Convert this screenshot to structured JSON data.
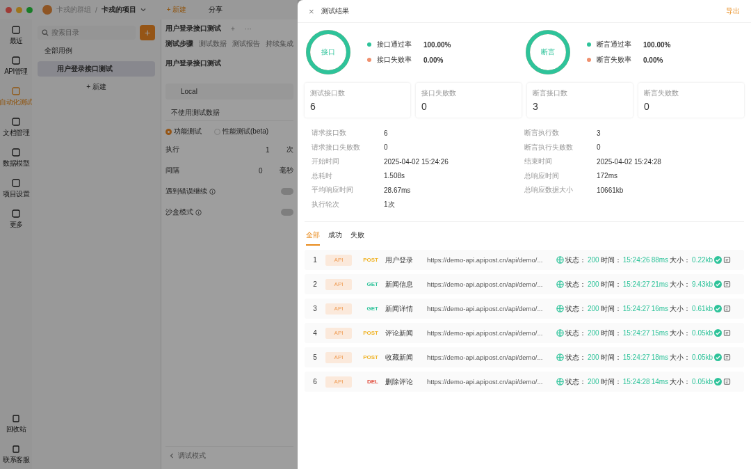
{
  "app": {
    "team": "卡戎的群组",
    "project": "卡戎的项目",
    "new_button": "+ 新建",
    "share_button": "分享",
    "separator": "/",
    "rail": [
      {
        "label": "最近",
        "selected": false
      },
      {
        "label": "API管理",
        "selected": false
      },
      {
        "label": "自动化测试",
        "selected": true
      },
      {
        "label": "文档管理",
        "selected": false
      },
      {
        "label": "数据模型",
        "selected": false
      },
      {
        "label": "项目设置",
        "selected": false
      },
      {
        "label": "更多",
        "selected": false
      }
    ],
    "rail_bottom": [
      {
        "label": "回收站"
      },
      {
        "label": "联系客服"
      }
    ],
    "tree": {
      "search": {
        "placeholder": "搜索目录"
      },
      "add": "+",
      "root": "全部用例",
      "items": [
        {
          "label": "用户登录接口测试",
          "selected": true
        }
      ],
      "new_item": "+ 新建"
    },
    "editor": {
      "tab_title": "用户登录接口测试",
      "tab_add": "+",
      "tab_more": "···",
      "tabs": [
        {
          "label": "测试步骤",
          "selected": true
        },
        {
          "label": "测试数据",
          "selected": false
        },
        {
          "label": "测试报告",
          "selected": false
        },
        {
          "label": "持续集成",
          "selected": false
        }
      ],
      "heading": "用户登录接口测试",
      "env": "Local",
      "data_select": "不使用测试数据",
      "modes": [
        {
          "label": "功能测试",
          "selected": true
        },
        {
          "label": "性能测试(beta)",
          "selected": false
        }
      ],
      "fields": [
        {
          "label": "执行",
          "value": "1",
          "unit": "次"
        },
        {
          "label": "间隔",
          "value": "0",
          "unit": "毫秒"
        }
      ],
      "toggles": [
        {
          "label": "遇到错误继续",
          "on": false
        },
        {
          "label": "沙盒模式",
          "on": false
        }
      ],
      "footer": "调试模式"
    }
  },
  "drawer": {
    "close": "×",
    "title": "测试结果",
    "export": "导出",
    "rings": [
      {
        "label": "接口",
        "level": 1,
        "legend": [
          {
            "label": "接口通过率",
            "value": "100.00%",
            "color": "#2ec39a"
          },
          {
            "label": "接口失败率",
            "value": "0.00%",
            "color": "#f0906e"
          }
        ]
      },
      {
        "label": "断言",
        "level": 1,
        "legend": [
          {
            "label": "断言通过率",
            "value": "100.00%",
            "color": "#2ec39a"
          },
          {
            "label": "断言失败率",
            "value": "0.00%",
            "color": "#f0906e"
          }
        ]
      }
    ],
    "cards": [
      {
        "label": "测试接口数",
        "value": "6"
      },
      {
        "label": "接口失败数",
        "value": "0"
      },
      {
        "label": "断言接口数",
        "value": "3"
      },
      {
        "label": "断言失败数",
        "value": "0"
      }
    ],
    "details_left": [
      {
        "label": "请求接口数",
        "value": "6"
      },
      {
        "label": "请求接口失败数",
        "value": "0"
      },
      {
        "label": "开始时间",
        "value": "2025-04-02 15:24:26"
      },
      {
        "label": "总耗时",
        "value": "1.508s"
      },
      {
        "label": "平均响应时间",
        "value": "28.67ms"
      },
      {
        "label": "执行轮次",
        "value": "1次"
      }
    ],
    "details_right": [
      {
        "label": "断言执行数",
        "value": "3"
      },
      {
        "label": "断言执行失败数",
        "value": "0"
      },
      {
        "label": "结束时间",
        "value": "2025-04-02 15:24:28"
      },
      {
        "label": "总响应时间",
        "value": "172ms"
      },
      {
        "label": "总响应数据大小",
        "value": "10661kb"
      }
    ],
    "filter_tabs": [
      {
        "label": "全部",
        "selected": true
      },
      {
        "label": "成功",
        "selected": false
      },
      {
        "label": "失败",
        "selected": false
      }
    ],
    "rows": [
      {
        "index": "1",
        "badge": "API",
        "method": "POST",
        "color": "#f0b429",
        "name": "用户登录",
        "url": "https://demo-api.apipost.cn/api/demo/...",
        "status_label": "状态：",
        "status": "200",
        "time_label": "时间：",
        "time": "15:24:26",
        "duration": "88ms",
        "size_label": "大小：",
        "size": "0.22kb"
      },
      {
        "index": "2",
        "badge": "API",
        "method": "GET",
        "color": "#2ec39a",
        "name": "新闻信息",
        "url": "https://demo-api.apipost.cn/api/demo/...",
        "status_label": "状态：",
        "status": "200",
        "time_label": "时间：",
        "time": "15:24:27",
        "duration": "21ms",
        "size_label": "大小：",
        "size": "9.43kb"
      },
      {
        "index": "3",
        "badge": "API",
        "method": "GET",
        "color": "#2ec39a",
        "name": "新闻详情",
        "url": "https://demo-api.apipost.cn/api/demo/...",
        "status_label": "状态：",
        "status": "200",
        "time_label": "时间：",
        "time": "15:24:27",
        "duration": "16ms",
        "size_label": "大小：",
        "size": "0.61kb"
      },
      {
        "index": "4",
        "badge": "API",
        "method": "POST",
        "color": "#f0b429",
        "name": "评论新闻",
        "url": "https://demo-api.apipost.cn/api/demo/...",
        "status_label": "状态：",
        "status": "200",
        "time_label": "时间：",
        "time": "15:24:27",
        "duration": "15ms",
        "size_label": "大小：",
        "size": "0.05kb"
      },
      {
        "index": "5",
        "badge": "API",
        "method": "POST",
        "color": "#f0b429",
        "name": "收藏新闻",
        "url": "https://demo-api.apipost.cn/api/demo/...",
        "status_label": "状态：",
        "status": "200",
        "time_label": "时间：",
        "time": "15:24:27",
        "duration": "18ms",
        "size_label": "大小：",
        "size": "0.05kb"
      },
      {
        "index": "6",
        "badge": "API",
        "method": "DEL",
        "color": "#e04a3a",
        "name": "删除评论",
        "url": "https://demo-api.apipost.cn/api/demo/...",
        "status_label": "状态：",
        "status": "200",
        "time_label": "时间：",
        "time": "15:24:28",
        "duration": "14ms",
        "size_label": "大小：",
        "size": "0.05kb"
      }
    ]
  }
}
